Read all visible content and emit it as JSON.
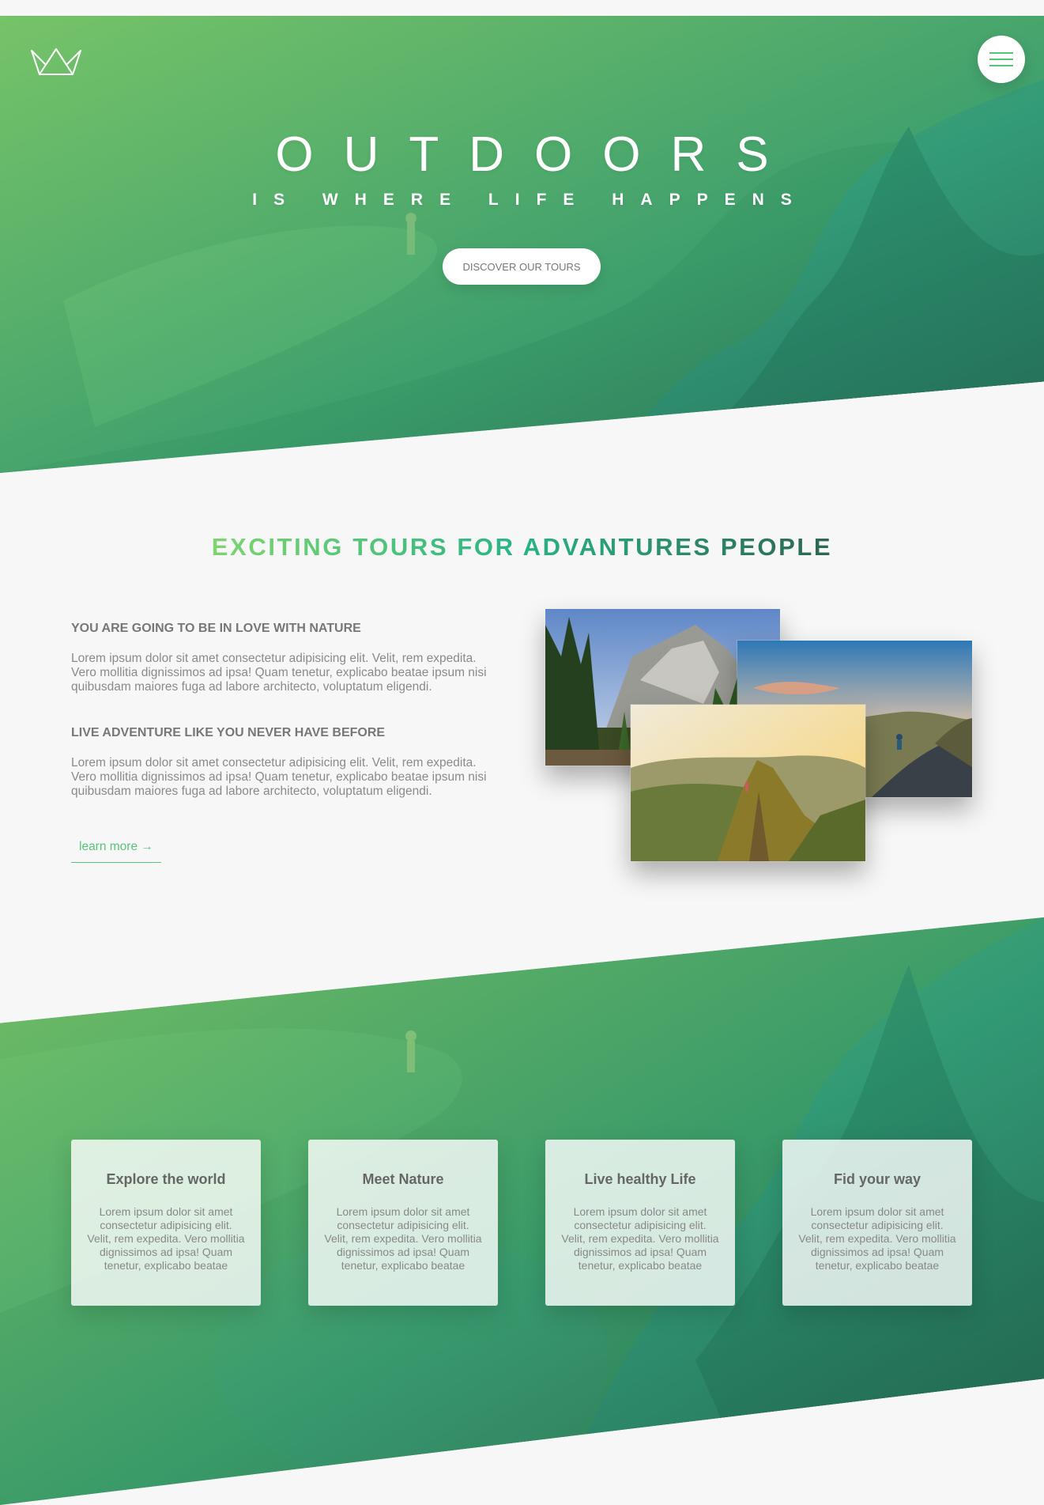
{
  "colors": {
    "primary": "#55c57a",
    "primary_light": "#7ed56f",
    "primary_dark": "#28b485",
    "background": "#f7f7f7",
    "text": "#777777"
  },
  "header": {
    "logo_icon": "crown-logo-icon",
    "menu_icon": "hamburger-menu-icon",
    "title_main": "OUTDOORS",
    "title_sub": "IS WHERE LIFE HAPPENS",
    "cta_label": "DISCOVER OUR TOURS"
  },
  "about": {
    "heading": "EXCITING TOURS FOR ADVANTURES PEOPLE",
    "blocks": [
      {
        "title": "YOU ARE GOING TO BE IN LOVE WITH NATURE",
        "text": "Lorem ipsum dolor sit amet consectetur adipisicing elit. Velit, rem expedita. Vero mollitia dignissimos ad ipsa! Quam tenetur, explicabo beatae ipsum nisi quibusdam maiores fuga ad labore architecto, voluptatum eligendi."
      },
      {
        "title": "LIVE ADVENTURE LIKE YOU NEVER HAVE BEFORE",
        "text": "Lorem ipsum dolor sit amet consectetur adipisicing elit. Velit, rem expedita. Vero mollitia dignissimos ad ipsa! Quam tenetur, explicabo beatae ipsum nisi quibusdam maiores fuga ad labore architecto, voluptatum eligendi."
      }
    ],
    "link_label": "learn more →"
  },
  "features": [
    {
      "title": "Explore the world",
      "text": "Lorem ipsum dolor sit amet consectetur adipisicing elit. Velit, rem expedita. Vero mollitia dignissimos ad ipsa! Quam tenetur, explicabo beatae"
    },
    {
      "title": "Meet Nature",
      "text": "Lorem ipsum dolor sit amet consectetur adipisicing elit. Velit, rem expedita. Vero mollitia dignissimos ad ipsa! Quam tenetur, explicabo beatae"
    },
    {
      "title": "Live healthy Life",
      "text": "Lorem ipsum dolor sit amet consectetur adipisicing elit. Velit, rem expedita. Vero mollitia dignissimos ad ipsa! Quam tenetur, explicabo beatae"
    },
    {
      "title": "Fid your way",
      "text": "Lorem ipsum dolor sit amet consectetur adipisicing elit. Velit, rem expedita. Vero mollitia dignissimos ad ipsa! Quam tenetur, explicabo beatae"
    }
  ]
}
